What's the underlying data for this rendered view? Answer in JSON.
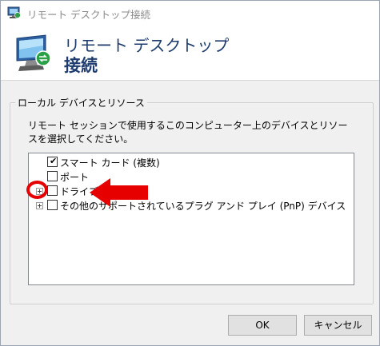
{
  "window": {
    "title": "リモート デスクトップ接続"
  },
  "banner": {
    "line1": "リモート デスクトップ",
    "line2": "接続"
  },
  "group": {
    "label": "ローカル デバイスとリソース",
    "description": "リモート セッションで使用するこのコンピューター上のデバイスとリソースを選択してください。"
  },
  "tree": {
    "items": [
      {
        "label": "スマート カード (複数)",
        "checked": true,
        "expandable": false
      },
      {
        "label": "ポート",
        "checked": false,
        "expandable": false
      },
      {
        "label": "ドライブ",
        "checked": false,
        "expandable": true
      },
      {
        "label": "その他のサポートされているプラグ アンド プレイ (PnP) デバイス",
        "checked": false,
        "expandable": true
      }
    ]
  },
  "buttons": {
    "ok": "OK",
    "cancel": "キャンセル"
  },
  "colors": {
    "banner_text": "#1f3c6e",
    "annotation": "#e60000"
  },
  "icons": {
    "title": "remote-desktop-icon",
    "banner": "remote-desktop-monitor-icon"
  }
}
